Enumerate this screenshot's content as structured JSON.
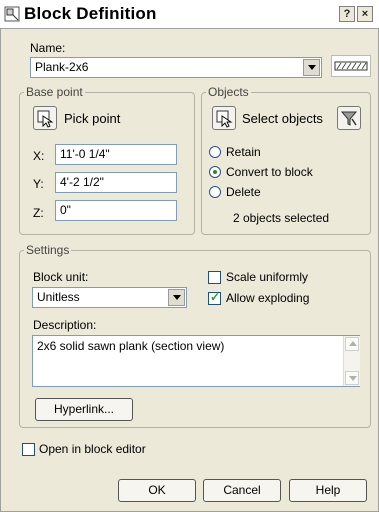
{
  "window": {
    "title": "Block Definition",
    "help_btn": "?",
    "close_btn": "×"
  },
  "name": {
    "label": "Name:",
    "value": "Plank-2x6"
  },
  "base_point": {
    "legend": "Base point",
    "pick_label": "Pick point",
    "x_label": "X:",
    "x_value": "11'-0 1/4\"",
    "y_label": "Y:",
    "y_value": "4'-2 1/2\"",
    "z_label": "Z:",
    "z_value": "0\""
  },
  "objects": {
    "legend": "Objects",
    "select_label": "Select objects",
    "retain": "Retain",
    "convert": "Convert to block",
    "delete": "Delete",
    "status": "2 objects selected",
    "selected_option": "Convert to block"
  },
  "settings": {
    "legend": "Settings",
    "unit_label": "Block unit:",
    "unit_value": "Unitless",
    "scale_uniformly": "Scale uniformly",
    "scale_uniformly_checked": false,
    "allow_exploding": "Allow exploding",
    "allow_exploding_checked": true,
    "description_label": "Description:",
    "description_value": "2x6 solid sawn plank (section view)",
    "hyperlink": "Hyperlink..."
  },
  "open_in_editor": {
    "label": "Open in block editor",
    "checked": false
  },
  "footer": {
    "ok": "OK",
    "cancel": "Cancel",
    "help": "Help"
  }
}
